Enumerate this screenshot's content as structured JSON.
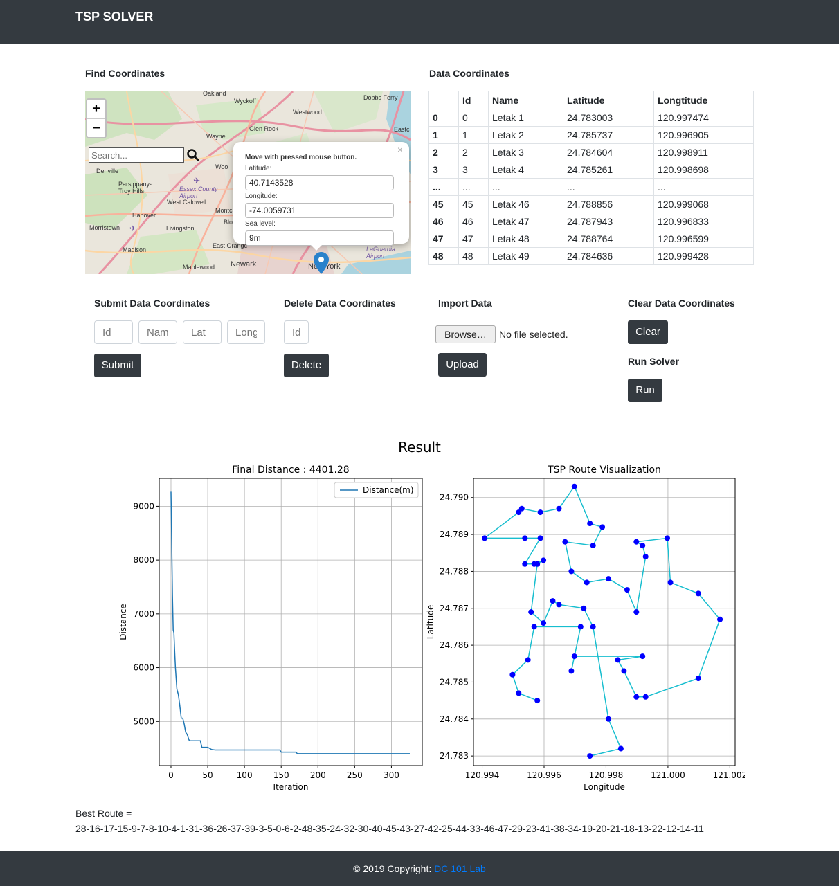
{
  "app": {
    "brand": "TSP SOLVER"
  },
  "find": {
    "heading": "Find Coordinates",
    "search_placeholder": "Search...",
    "zoom_in": "+",
    "zoom_out": "−",
    "popup": {
      "close": "×",
      "title": "Move with pressed mouse button.",
      "lat_label": "Latitude:",
      "lat_value": "40.7143528",
      "lng_label": "Longitude:",
      "lng_value": "-74.0059731",
      "sea_label": "Sea level:",
      "sea_value": "9m"
    },
    "map_labels": {
      "oakland": "Oakland",
      "wyckoff": "Wyckoff",
      "dobbs": "Dobbs Ferry",
      "westwood": "Westwood",
      "glenrock": "Glen Rock",
      "eastc": "Eastc",
      "wayne": "Wayne",
      "denville": "Denville",
      "parsippany": "Parsippany-\nTroy Hills",
      "essex": "Essex County\nAirport",
      "westcaldwell": "West Caldwell",
      "hanover": "Hanover",
      "montc": "Montc",
      "blo": "Blo",
      "morristown": "Morristown",
      "livingston": "Livingston",
      "madison": "Madison",
      "eastorange": "East Orange",
      "newark": "Newark",
      "maplewood": "Maplewood",
      "newyork": "New York",
      "laguardia": "LaGuardia\nAirport",
      "woo": "Woo"
    }
  },
  "data_coords": {
    "heading": "Data Coordinates",
    "columns": [
      "",
      "Id",
      "Name",
      "Latitude",
      "Longtitude"
    ],
    "rows": [
      [
        "0",
        "0",
        "Letak 1",
        "24.783003",
        "120.997474"
      ],
      [
        "1",
        "1",
        "Letak 2",
        "24.785737",
        "120.996905"
      ],
      [
        "2",
        "2",
        "Letak 3",
        "24.784604",
        "120.998911"
      ],
      [
        "3",
        "3",
        "Letak 4",
        "24.785261",
        "120.998698"
      ],
      [
        "...",
        "...",
        "...",
        "...",
        "..."
      ],
      [
        "45",
        "45",
        "Letak 46",
        "24.788856",
        "120.999068"
      ],
      [
        "46",
        "46",
        "Letak 47",
        "24.787943",
        "120.996833"
      ],
      [
        "47",
        "47",
        "Letak 48",
        "24.788764",
        "120.996599"
      ],
      [
        "48",
        "48",
        "Letak 49",
        "24.784636",
        "120.999428"
      ]
    ]
  },
  "submit": {
    "heading": "Submit Data Coordinates",
    "id_placeholder": "Id",
    "name_placeholder": "Nam",
    "lat_placeholder": "Lat",
    "long_placeholder": "Long",
    "button": "Submit"
  },
  "delete": {
    "heading": "Delete Data Coordinates",
    "id_placeholder": "Id",
    "button": "Delete"
  },
  "import": {
    "heading": "Import Data",
    "browse": "Browse…",
    "no_file": "No file selected.",
    "button": "Upload"
  },
  "clear": {
    "heading": "Clear Data Coordinates",
    "button": "Clear"
  },
  "run": {
    "heading": "Run Solver",
    "button": "Run"
  },
  "result": {
    "title": "Result",
    "best_route_label": "Best Route =",
    "best_route": "28-16-17-15-9-7-8-10-4-1-31-36-26-37-39-3-5-0-6-2-48-35-24-32-30-40-45-43-27-42-25-44-33-46-47-29-23-41-38-34-19-20-21-18-13-22-12-14-11"
  },
  "footer": {
    "text": "© 2019 Copyright: ",
    "link": "DC 101 Lab"
  },
  "chart_data": [
    {
      "type": "line",
      "title": "Final Distance : 4401.28",
      "xlabel": "Iteration",
      "ylabel": "Distance",
      "xlim": [
        -16,
        342
      ],
      "ylim": [
        4180,
        9520
      ],
      "xticks": [
        0,
        50,
        100,
        150,
        200,
        250,
        300
      ],
      "yticks": [
        5000,
        6000,
        7000,
        8000,
        9000
      ],
      "grid": true,
      "legend": "top-right",
      "color": "#1f77b4",
      "series": [
        {
          "name": "Distance(m)",
          "x": [
            0,
            2,
            3,
            4,
            5,
            6,
            8,
            10,
            12,
            14,
            15,
            16,
            18,
            20,
            22,
            25,
            28,
            30,
            32,
            35,
            38,
            40,
            42,
            45,
            50,
            55,
            60,
            80,
            100,
            120,
            140,
            148,
            150,
            160,
            170,
            172,
            175,
            200,
            250,
            300,
            325
          ],
          "y": [
            9270,
            7350,
            6700,
            6650,
            6300,
            6000,
            5600,
            5500,
            5300,
            5060,
            5060,
            5060,
            4950,
            4800,
            4760,
            4640,
            4640,
            4640,
            4640,
            4640,
            4640,
            4640,
            4520,
            4520,
            4520,
            4480,
            4470,
            4470,
            4470,
            4470,
            4470,
            4470,
            4430,
            4430,
            4430,
            4400,
            4400,
            4400,
            4400,
            4400,
            4400
          ]
        }
      ]
    },
    {
      "type": "scatter",
      "title": "TSP Route Visualization",
      "xlabel": "Longitude",
      "ylabel": "Latitude",
      "xlim": [
        120.99372,
        121.00217
      ],
      "ylim": [
        24.78274,
        24.79052
      ],
      "xticks": [
        120.994,
        120.996,
        120.998,
        121.0,
        121.002
      ],
      "yticks": [
        24.783,
        24.784,
        24.785,
        24.786,
        24.787,
        24.788,
        24.789,
        24.79
      ],
      "grid": true,
      "line_color": "#17becf",
      "point_color": "#0000ff",
      "route": [
        [
          120.99748,
          24.783
        ],
        [
          120.99848,
          24.7832
        ],
        [
          120.99808,
          24.784
        ],
        [
          120.99758,
          24.7865
        ],
        [
          120.99728,
          24.787
        ],
        [
          120.99648,
          24.7871
        ],
        [
          120.99628,
          24.7872
        ],
        [
          120.99598,
          24.7866
        ],
        [
          120.99558,
          24.7869
        ],
        [
          120.99578,
          24.7882
        ],
        [
          120.99598,
          24.7883
        ],
        [
          120.99568,
          24.7882
        ],
        [
          120.99538,
          24.7882
        ],
        [
          120.99588,
          24.7889
        ],
        [
          120.99538,
          24.7889
        ],
        [
          120.99408,
          24.7889
        ],
        [
          120.99518,
          24.7896
        ],
        [
          120.99528,
          24.7897
        ],
        [
          120.99588,
          24.7896
        ],
        [
          120.99648,
          24.7897
        ],
        [
          120.99698,
          24.7903
        ],
        [
          120.99748,
          24.7893
        ],
        [
          120.99788,
          24.7892
        ],
        [
          120.99758,
          24.7887
        ],
        [
          120.99668,
          24.7888
        ],
        [
          120.99688,
          24.788
        ],
        [
          120.99738,
          24.7877
        ],
        [
          120.99808,
          24.7878
        ],
        [
          120.99868,
          24.7875
        ],
        [
          120.99898,
          24.7869
        ],
        [
          120.99928,
          24.7884
        ],
        [
          120.99918,
          24.7887
        ],
        [
          120.99898,
          24.7888
        ],
        [
          120.99998,
          24.7889
        ],
        [
          121.00008,
          24.7877
        ],
        [
          121.00098,
          24.7874
        ],
        [
          121.00168,
          24.7867
        ],
        [
          121.00098,
          24.7851
        ],
        [
          120.99928,
          24.7846
        ],
        [
          120.99898,
          24.7846
        ],
        [
          120.99858,
          24.7853
        ],
        [
          120.99838,
          24.7856
        ],
        [
          120.99918,
          24.7857
        ],
        [
          120.99698,
          24.7857
        ],
        [
          120.99688,
          24.7853
        ],
        [
          120.99718,
          24.7865
        ],
        [
          120.99568,
          24.7865
        ],
        [
          120.99548,
          24.7856
        ],
        [
          120.99498,
          24.7852
        ],
        [
          120.99518,
          24.7847
        ],
        [
          120.99578,
          24.7845
        ]
      ]
    }
  ]
}
